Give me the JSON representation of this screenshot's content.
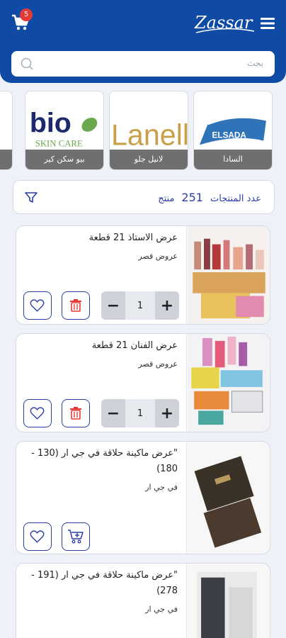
{
  "header": {
    "cart_count": "5",
    "logo_text": "Zassar"
  },
  "search": {
    "placeholder": "بحث"
  },
  "brands": [
    {
      "label": "السادا",
      "logo_text": "ELSADA"
    },
    {
      "label": "لانيل جلو",
      "logo_text": "Lanell"
    },
    {
      "label": "بيو سكن كير",
      "logo_text": "bio",
      "logo_sub": "SKIN CARE"
    }
  ],
  "results": {
    "label": "عدد المنتجات",
    "count": "251",
    "unit": "منتج"
  },
  "products": [
    {
      "title": "عرض الاستاذ 21 قطعة",
      "brand": "عروض قصر",
      "qty": "1"
    },
    {
      "title": "عرض الفنان 21 قطعة",
      "brand": "عروض قصر",
      "qty": "1"
    },
    {
      "title": "\"عرض ماكينة حلاقة في جي ار (130 - 180)",
      "brand": "في جي ار"
    },
    {
      "title": "\"عرض ماكينة حلاقة في جي ار (191 - 278)",
      "brand": "في جي ار"
    }
  ],
  "colors": {
    "primary": "#0f4aa5",
    "accent": "#2a3ea6",
    "delete": "#e53935"
  },
  "icons": [
    "cart-icon",
    "menu-icon",
    "search-icon",
    "filter-icon",
    "heart-icon",
    "trash-icon",
    "add-to-cart-icon"
  ]
}
